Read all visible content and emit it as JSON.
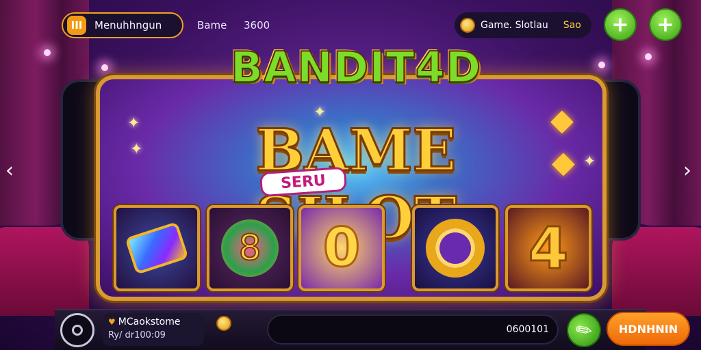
{
  "header": {
    "menu_logo": "III",
    "menu_label": "Menuhhngun",
    "center_label": "Bame",
    "center_value": "3600",
    "game_label": "Game. Slotlau",
    "game_amount": "Sao",
    "plus_symbol": "+"
  },
  "banner": {
    "brand": "BANDIT4D",
    "title": "BAME SILOT",
    "tag": "SERU"
  },
  "reels": [
    {
      "symbol_name": "gem-icon",
      "text": ""
    },
    {
      "symbol_name": "star-badge-icon",
      "text": "8"
    },
    {
      "symbol_name": "sun-icon",
      "text": "0"
    },
    {
      "symbol_name": "ring-icon",
      "text": ""
    },
    {
      "symbol_name": "number-icon",
      "text": "4"
    }
  ],
  "nav": {
    "left": "‹",
    "right": "›"
  },
  "footer": {
    "user_name": "MCaokstome",
    "user_sub": "Ry/ dr100:09",
    "bet_value": "0600101",
    "action_label": "HDNHNIN"
  },
  "colors": {
    "accent_orange": "#f3a21b",
    "accent_green": "#3aa012",
    "frame_gold": "#d99a32"
  }
}
